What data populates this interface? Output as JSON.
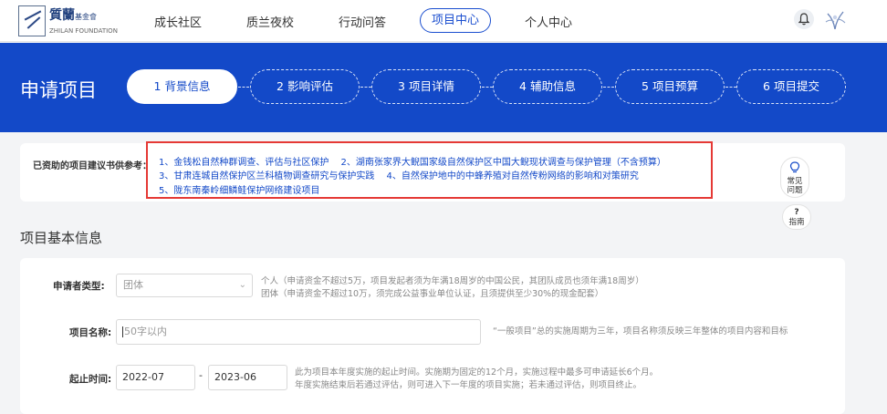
{
  "brand": {
    "name_cn": "質蘭",
    "name_cn_sub": "基金會",
    "name_en": "ZHILAN FOUNDATION"
  },
  "nav": {
    "items": [
      {
        "label": "成长社区"
      },
      {
        "label": "质兰夜校"
      },
      {
        "label": "行动问答"
      },
      {
        "label": "项目中心",
        "active": true
      },
      {
        "label": "个人中心"
      }
    ],
    "bell_icon": "bell-icon",
    "avatar_icon": "orchid-avatar-icon"
  },
  "header": {
    "title": "申请项目",
    "steps": [
      {
        "label": "1 背景信息",
        "active": true
      },
      {
        "label": "2 影响评估"
      },
      {
        "label": "3 项目详情"
      },
      {
        "label": "4 辅助信息"
      },
      {
        "label": "5 项目预算"
      },
      {
        "label": "6 项目提交"
      }
    ]
  },
  "reference": {
    "label": "已资助的项目建议书供参考：",
    "lines": [
      "1、金钱松自然种群调查、评估与社区保护　 2、湖南张家界大鲵国家级自然保护区中国大鲵现状调查与保护管理（不含预算）",
      "3、甘肃连城自然保护区兰科植物调查研究与保护实践　 4、自然保护地中的中蜂养殖对自然传粉网络的影响和对策研究",
      "5、陇东南秦岭细鳞鲑保护网络建设项目"
    ]
  },
  "help": {
    "faq_label_1": "常见",
    "faq_label_2": "问题",
    "guide_glyph": "?",
    "guide_label": "指南"
  },
  "section": {
    "title": "项目基本信息"
  },
  "form": {
    "applicant_type": {
      "label": "申请者类型:",
      "value": "团体",
      "hint_1": "个人（申请资金不超过5万，项目发起者须为年满18周岁的中国公民，其团队成员也须年满18周岁）",
      "hint_2": "团体（申请资金不超过10万，须完成公益事业单位认证，且须提供至少30%的现金配套）"
    },
    "project_name": {
      "label": "项目名称:",
      "placeholder": "50字以内",
      "hint": "“一般项目”总的实施周期为三年，项目名称须反映三年整体的项目内容和目标"
    },
    "period": {
      "label": "起止时间:",
      "start": "2022-07",
      "separator": "-",
      "end": "2023-06",
      "hint_1": "此为项目本年度实施的起止时间。实施期为固定的12个月，实施过程中最多可申请延长6个月。",
      "hint_2": "年度实施结束后若通过评估，则可进入下一年度的项目实施；若未通过评估，则项目终止。"
    }
  },
  "colors": {
    "primary": "#1349c8",
    "highlight_border": "#e53935",
    "background": "#f3f4f6"
  }
}
